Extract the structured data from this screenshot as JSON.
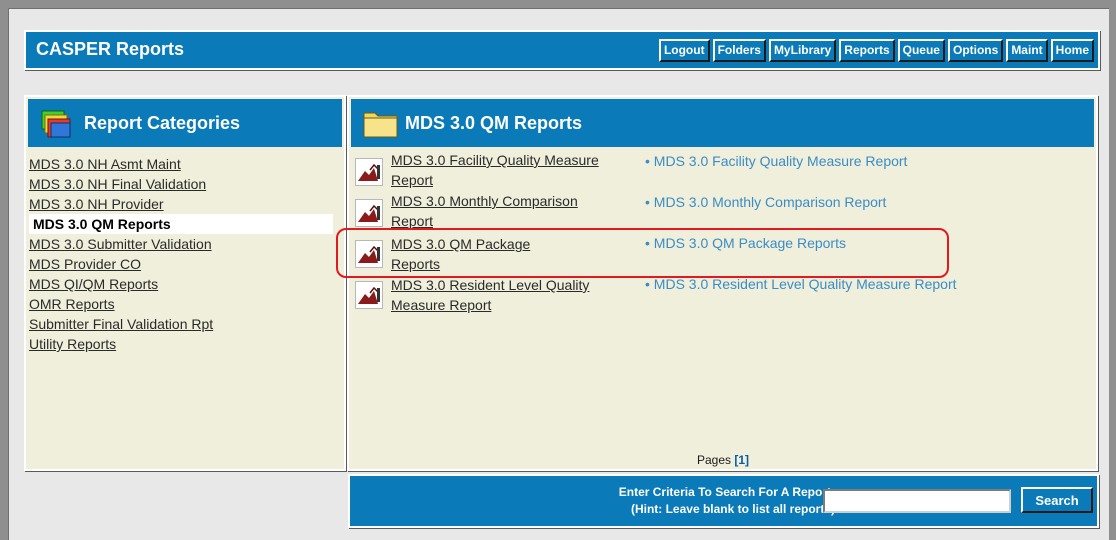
{
  "app": {
    "title": "CASPER Reports"
  },
  "nav": [
    "Logout",
    "Folders",
    "MyLibrary",
    "Reports",
    "Queue",
    "Options",
    "Maint",
    "Home"
  ],
  "left_panel": {
    "title": "Report Categories",
    "icon": "folders-stack-icon",
    "categories": [
      "MDS 3.0 NH Asmt Maint",
      "MDS 3.0 NH Final Validation",
      "MDS 3.0 NH Provider",
      "MDS 3.0 QM Reports",
      "MDS 3.0 Submitter Validation",
      "MDS Provider CO",
      "MDS QI/QM Reports",
      "OMR Reports",
      "Submitter Final Validation Rpt",
      "Utility Reports"
    ],
    "active_category": "MDS 3.0 QM Reports"
  },
  "right_panel": {
    "title": "MDS 3.0 QM Reports",
    "icon": "folder-icon",
    "reports": [
      {
        "link": "MDS 3.0 Facility Quality Measure Report",
        "bullet": "MDS 3.0 Facility Quality Measure Report"
      },
      {
        "link": "MDS 3.0 Monthly Comparison Report",
        "bullet": "MDS 3.0 Monthly Comparison Report"
      },
      {
        "link": "MDS 3.0 QM Package Reports",
        "bullet": "MDS 3.0 QM Package Reports"
      },
      {
        "link": "MDS 3.0 Resident Level Quality Measure Report",
        "bullet": "MDS 3.0 Resident Level Quality Measure Report"
      }
    ],
    "pages_label": "Pages",
    "current_page": "[1]"
  },
  "search": {
    "label_line1": "Enter Criteria To Search For A Report:",
    "label_line2": "(Hint: Leave blank to list all reports)",
    "value": "",
    "button": "Search"
  },
  "colors": {
    "header_blue": "#0a7ab8",
    "panel_bg": "#f0efdc",
    "highlight_red": "#e2191e",
    "bullet_link": "#3a8cc4"
  }
}
